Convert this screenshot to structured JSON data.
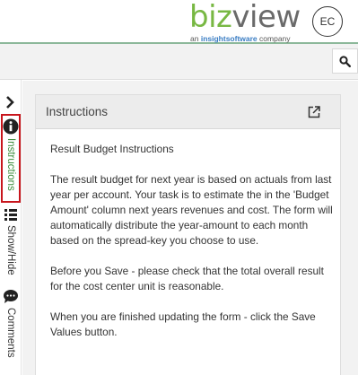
{
  "brand": {
    "logo_part1": "biz",
    "logo_part2": "view",
    "tagline_prefix": "an",
    "tagline_brand": "insightsoftware",
    "tagline_suffix": "company",
    "accent_color": "#78b843"
  },
  "user": {
    "initials": "EC"
  },
  "toolbar": {
    "search_icon": "search-icon"
  },
  "sidebar": {
    "items": [
      {
        "label": "Instructions",
        "icon": "info-icon",
        "active": true,
        "color": "#3c8c3c",
        "highlight": "#c8161d"
      },
      {
        "label": "Show/Hide",
        "icon": "list-icon",
        "active": false
      },
      {
        "label": "Comments",
        "icon": "comment-icon",
        "active": false
      }
    ]
  },
  "panel": {
    "title": "Instructions",
    "body": [
      "Result Budget Instructions",
      "The result budget for next year is based on actuals from last year per account. Your task is to estimate the in the 'Budget Amount' column next years revenues and cost. The form will automatically distribute the year-amount to each month based on the spread-key you choose to use.",
      "Before you Save - please check that the total overall result for the cost center unit is reasonable.",
      "When you are finished updating the form - click the Save Values button."
    ]
  }
}
